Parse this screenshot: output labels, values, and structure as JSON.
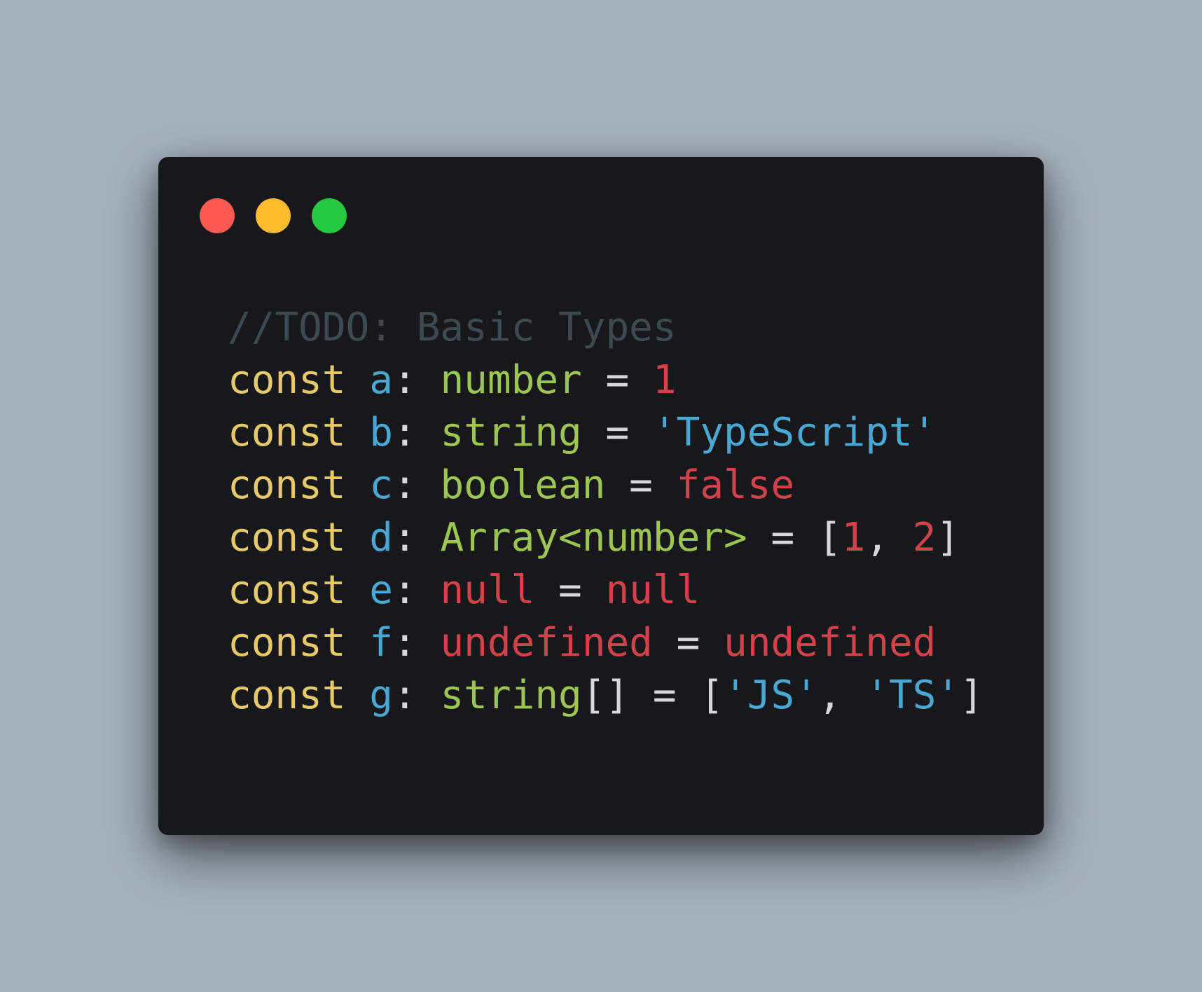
{
  "window": {
    "traffic_lights": [
      {
        "name": "close",
        "color": "#ff5a52"
      },
      {
        "name": "minimize",
        "color": "#fdbb2d"
      },
      {
        "name": "maximize",
        "color": "#27c940"
      }
    ]
  },
  "colors": {
    "comment": "#3e4a52",
    "keyword": "#e6c96a",
    "identifier": "#4aa8d4",
    "punctuation": "#d6d8dc",
    "type": "#9ec451",
    "number": "#d2424a",
    "literal": "#d2424a",
    "string": "#4aa8d4"
  },
  "code": {
    "lines": [
      [
        {
          "t": "//TODO: Basic Types",
          "k": "comment"
        }
      ],
      [
        {
          "t": "const",
          "k": "keyword"
        },
        {
          "t": " ",
          "k": "punctuation"
        },
        {
          "t": "a",
          "k": "identifier"
        },
        {
          "t": ": ",
          "k": "punctuation"
        },
        {
          "t": "number",
          "k": "type"
        },
        {
          "t": " = ",
          "k": "punctuation"
        },
        {
          "t": "1",
          "k": "number"
        }
      ],
      [
        {
          "t": "const",
          "k": "keyword"
        },
        {
          "t": " ",
          "k": "punctuation"
        },
        {
          "t": "b",
          "k": "identifier"
        },
        {
          "t": ": ",
          "k": "punctuation"
        },
        {
          "t": "string",
          "k": "type"
        },
        {
          "t": " = ",
          "k": "punctuation"
        },
        {
          "t": "'TypeScript'",
          "k": "string"
        }
      ],
      [
        {
          "t": "const",
          "k": "keyword"
        },
        {
          "t": " ",
          "k": "punctuation"
        },
        {
          "t": "c",
          "k": "identifier"
        },
        {
          "t": ": ",
          "k": "punctuation"
        },
        {
          "t": "boolean",
          "k": "type"
        },
        {
          "t": " = ",
          "k": "punctuation"
        },
        {
          "t": "false",
          "k": "literal"
        }
      ],
      [
        {
          "t": "const",
          "k": "keyword"
        },
        {
          "t": " ",
          "k": "punctuation"
        },
        {
          "t": "d",
          "k": "identifier"
        },
        {
          "t": ": ",
          "k": "punctuation"
        },
        {
          "t": "Array<number>",
          "k": "type"
        },
        {
          "t": " = [",
          "k": "punctuation"
        },
        {
          "t": "1",
          "k": "number"
        },
        {
          "t": ", ",
          "k": "punctuation"
        },
        {
          "t": "2",
          "k": "number"
        },
        {
          "t": "]",
          "k": "punctuation"
        }
      ],
      [
        {
          "t": "const",
          "k": "keyword"
        },
        {
          "t": " ",
          "k": "punctuation"
        },
        {
          "t": "e",
          "k": "identifier"
        },
        {
          "t": ": ",
          "k": "punctuation"
        },
        {
          "t": "null",
          "k": "literal"
        },
        {
          "t": " = ",
          "k": "punctuation"
        },
        {
          "t": "null",
          "k": "literal"
        }
      ],
      [
        {
          "t": "const",
          "k": "keyword"
        },
        {
          "t": " ",
          "k": "punctuation"
        },
        {
          "t": "f",
          "k": "identifier"
        },
        {
          "t": ": ",
          "k": "punctuation"
        },
        {
          "t": "undefined",
          "k": "literal"
        },
        {
          "t": " = ",
          "k": "punctuation"
        },
        {
          "t": "undefined",
          "k": "literal"
        }
      ],
      [
        {
          "t": "const",
          "k": "keyword"
        },
        {
          "t": " ",
          "k": "punctuation"
        },
        {
          "t": "g",
          "k": "identifier"
        },
        {
          "t": ": ",
          "k": "punctuation"
        },
        {
          "t": "string",
          "k": "type"
        },
        {
          "t": "[] = [",
          "k": "punctuation"
        },
        {
          "t": "'JS'",
          "k": "string"
        },
        {
          "t": ", ",
          "k": "punctuation"
        },
        {
          "t": "'TS'",
          "k": "string"
        },
        {
          "t": "]",
          "k": "punctuation"
        }
      ]
    ]
  }
}
